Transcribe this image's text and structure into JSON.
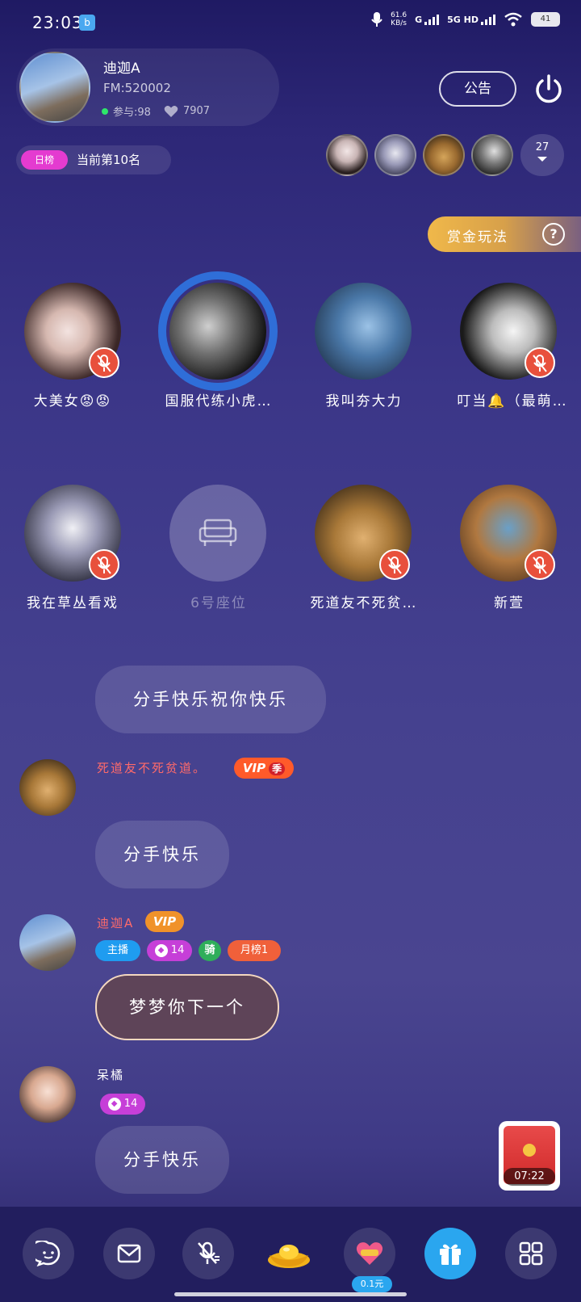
{
  "status": {
    "time": "23:03",
    "net_speed_value": "61.6",
    "net_speed_unit": "KB/s",
    "net1": "G",
    "net2": "5G HD",
    "battery": "41"
  },
  "room": {
    "name": "迪迦A",
    "fm": "FM:520002",
    "participants": "参与:98",
    "likes": "7907",
    "notice_label": "公告",
    "rank_tag": "日榜",
    "rank_text": "当前第10名",
    "audience_count": "27",
    "bounty_label": "赏金玩法",
    "help": "?"
  },
  "seats": [
    {
      "name": "大美女😡😡",
      "muted": true
    },
    {
      "name": "国服代练小虎…",
      "muted": false,
      "host": true
    },
    {
      "name": "我叫夯大力",
      "muted": false
    },
    {
      "name": "叮当🔔（最萌…",
      "muted": true
    },
    {
      "name": "我在草丛看戏",
      "muted": true
    },
    {
      "name": "6号座位",
      "muted": false,
      "empty": true
    },
    {
      "name": "死道友不死贫…",
      "muted": true
    },
    {
      "name": "新萱",
      "muted": true
    }
  ],
  "chat": {
    "m0": {
      "text": "分手快乐祝你快乐"
    },
    "m1": {
      "user": "死道友不死贫道。",
      "vip": "VIP",
      "vip_sub": "季",
      "text": "分手快乐"
    },
    "m2": {
      "user": "迪迦A",
      "vip": "VIP",
      "tag_host": "主播",
      "level": "14",
      "ride": "骑",
      "tag_month": "月榜1",
      "text": "梦梦你下一个"
    },
    "m3": {
      "user": "呆橘",
      "level": "14",
      "text": "分手快乐"
    }
  },
  "redpack": {
    "timer": "07:22"
  },
  "bottom": {
    "price": "0.1元"
  }
}
